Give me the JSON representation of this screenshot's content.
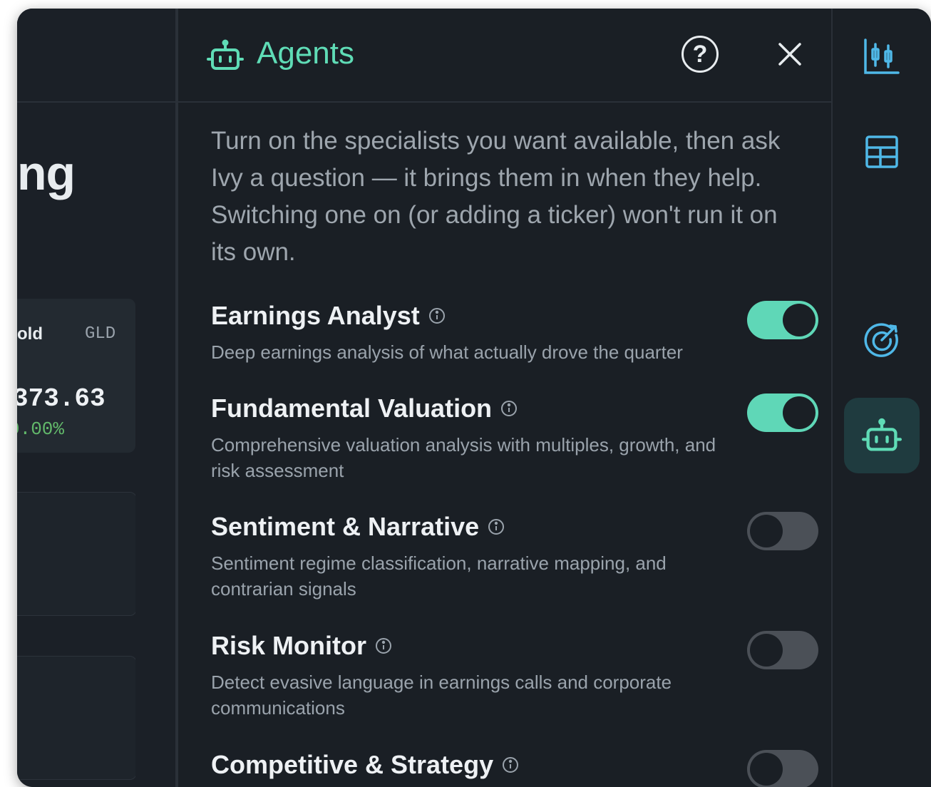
{
  "left": {
    "title_fragment": "ng",
    "quote": {
      "name": "old",
      "ticker": "GLD",
      "price": "373.63",
      "change": "0.00%"
    }
  },
  "panel": {
    "title": "Agents",
    "help_glyph": "?",
    "intro": "Turn on the specialists you want available, then ask Ivy a question — it brings them in when they help. Switching one on (or adding a ticker) won't run it on its own.",
    "agents": [
      {
        "name": "Earnings Analyst",
        "desc": "Deep earnings analysis of what actually drove the quarter",
        "enabled": true
      },
      {
        "name": "Fundamental Valuation",
        "desc": "Comprehensive valuation analysis with multiples, growth, and risk assessment",
        "enabled": true
      },
      {
        "name": "Sentiment & Narrative",
        "desc": "Sentiment regime classification, narrative mapping, and contrarian signals",
        "enabled": false
      },
      {
        "name": "Risk Monitor",
        "desc": "Detect evasive language in earnings calls and corporate communications",
        "enabled": false
      },
      {
        "name": "Competitive & Strategy",
        "desc": "",
        "enabled": false
      }
    ]
  },
  "rail": {
    "items": [
      {
        "icon": "candlestick-chart-icon",
        "active": false
      },
      {
        "icon": "table-grid-icon",
        "active": false
      },
      {
        "icon": "target-icon",
        "active": false
      },
      {
        "icon": "robot-icon",
        "active": true
      }
    ]
  },
  "colors": {
    "accent": "#5fdcb6",
    "rail_icon": "#4fb8e8",
    "toggle_on": "#5fd7b7",
    "toggle_off": "#4b5057"
  }
}
